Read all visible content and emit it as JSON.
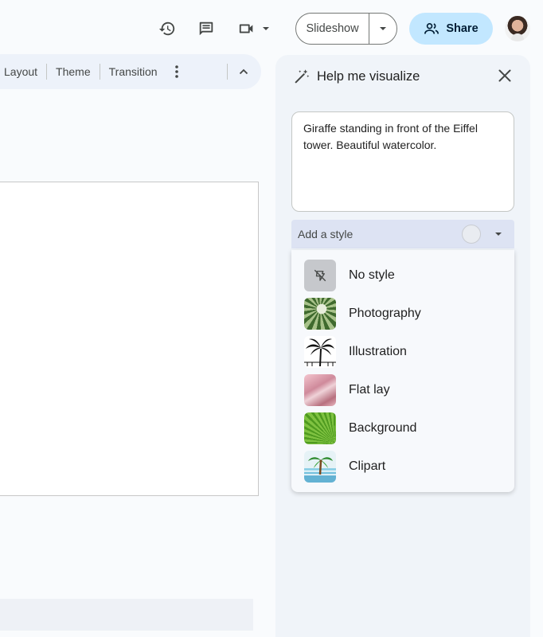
{
  "header": {
    "slideshow_label": "Slideshow",
    "share_label": "Share"
  },
  "toolbar": {
    "items": [
      "Layout",
      "Theme",
      "Transition"
    ]
  },
  "panel": {
    "title": "Help me visualize",
    "prompt_text": "Giraffe standing in front of the Eiffel tower. Beautiful watercolor.",
    "style_placeholder": "Add a style",
    "styles": [
      {
        "label": "No style",
        "thumb": "no-style-icon"
      },
      {
        "label": "Photography",
        "thumb": "photography-thumbnail"
      },
      {
        "label": "Illustration",
        "thumb": "illustration-thumbnail"
      },
      {
        "label": "Flat lay",
        "thumb": "flat-lay-thumbnail"
      },
      {
        "label": "Background",
        "thumb": "background-thumbnail"
      },
      {
        "label": "Clipart",
        "thumb": "clipart-thumbnail"
      }
    ]
  },
  "colors": {
    "page_bg": "#f9fbfd",
    "panel_bg": "#f0f4f9",
    "share_bg": "#c2e7ff",
    "select_bg": "#dde3f3"
  }
}
